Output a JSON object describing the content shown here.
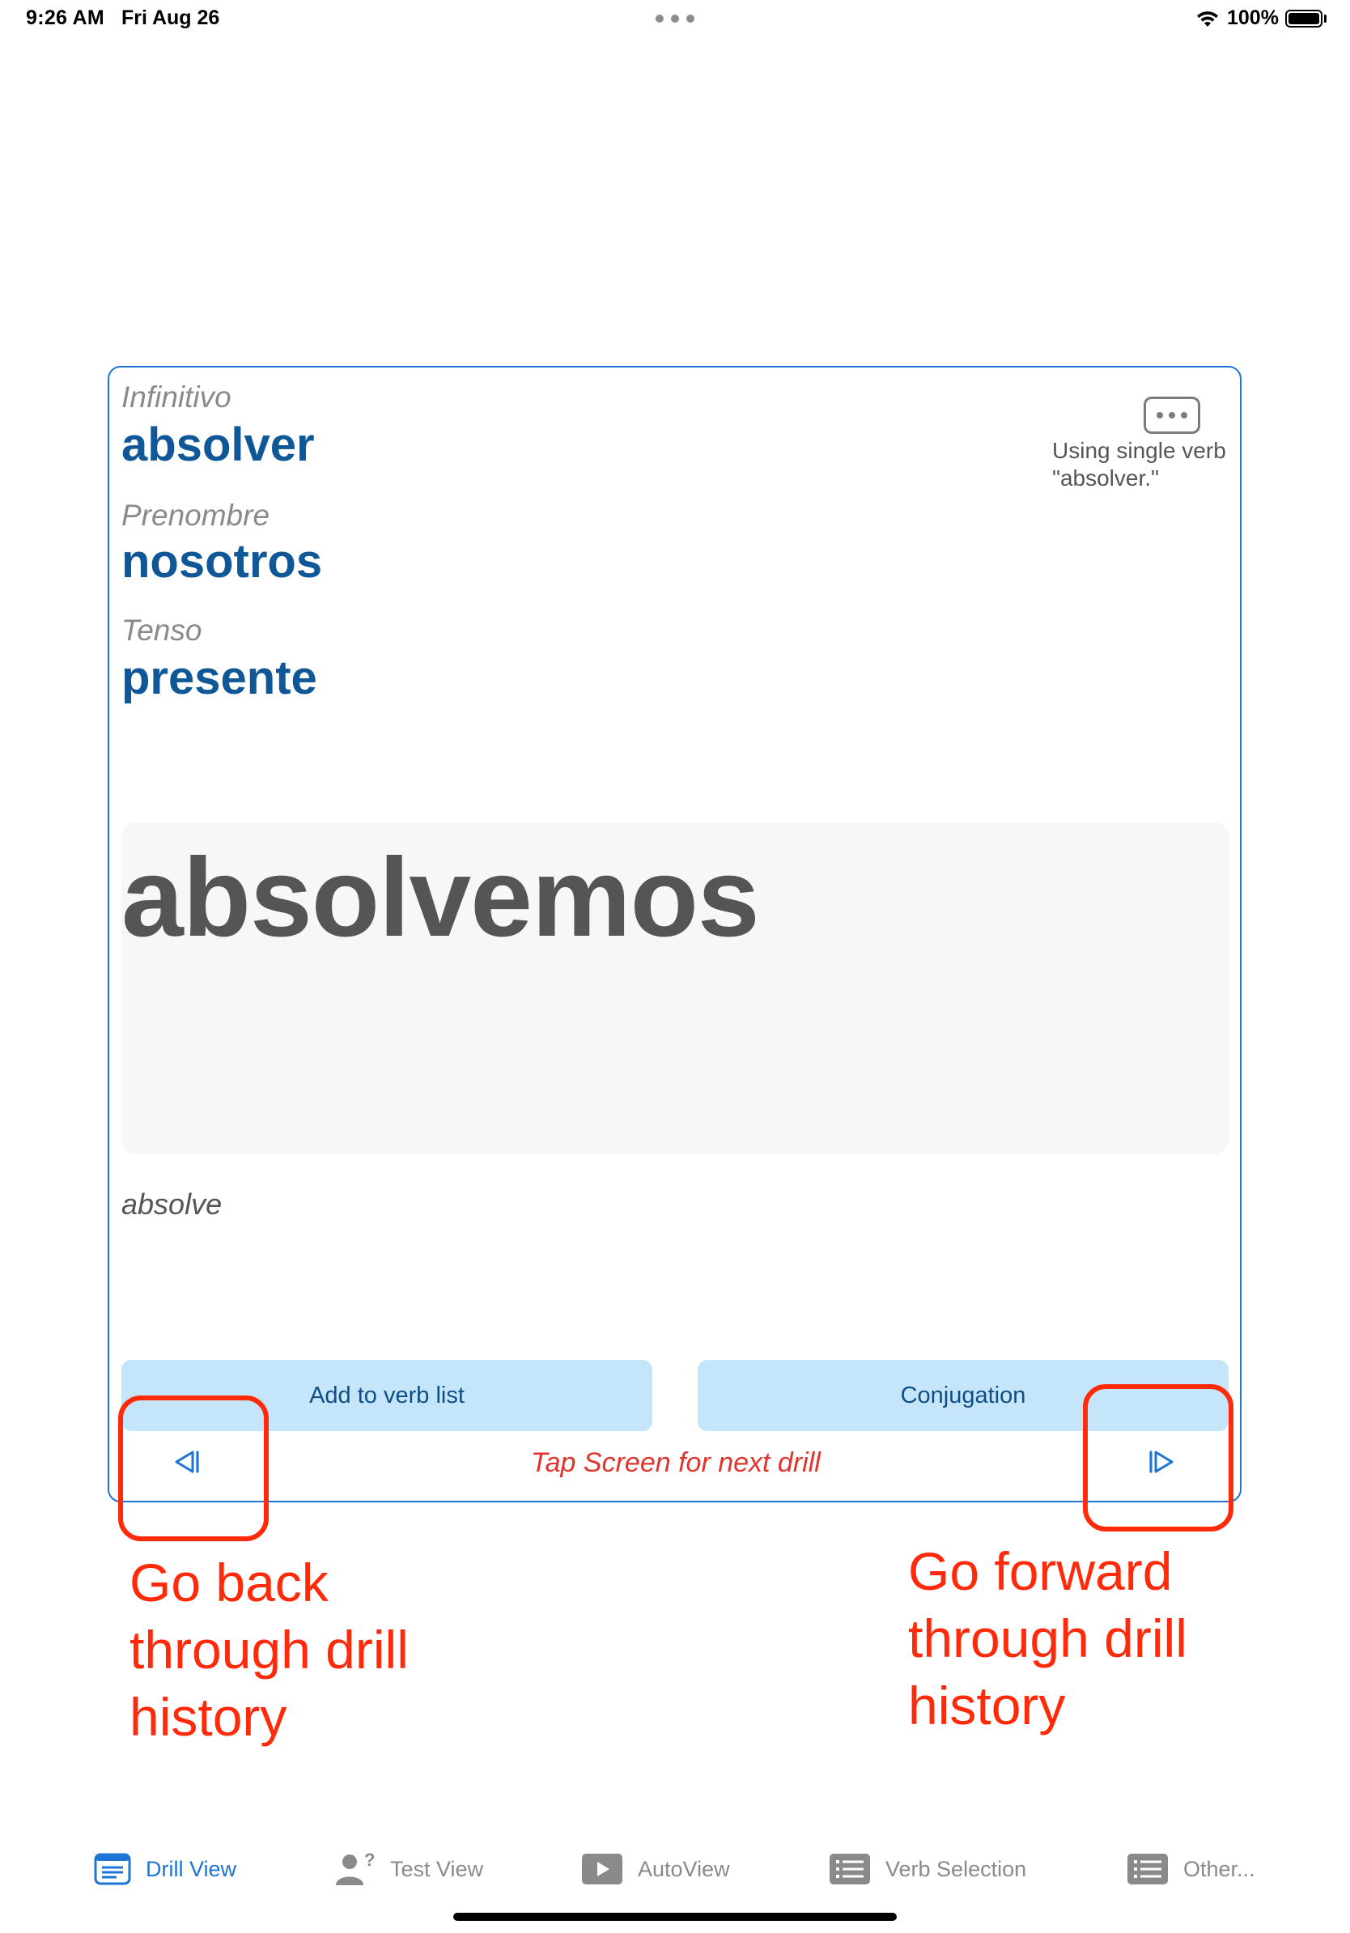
{
  "status_bar": {
    "time": "9:26 AM",
    "date": "Fri Aug 26",
    "battery": "100%"
  },
  "drill": {
    "infinitive_label": "Infinitivo",
    "infinitive_value": "absolver",
    "pronoun_label": "Prenombre",
    "pronoun_value": "nosotros",
    "tense_label": "Tenso",
    "tense_value": "presente",
    "single_verb_note": "Using single verb \"absolver.\"",
    "answer": "absolvemos",
    "hint": "absolve",
    "add_button": "Add to verb list",
    "conjugation_button": "Conjugation",
    "tap_hint": "Tap Screen for next drill"
  },
  "annotations": {
    "back": "Go back through drill history",
    "forward": "Go forward through drill history"
  },
  "tabs": [
    {
      "label": "Drill View",
      "icon": "drill-view-icon",
      "active": true
    },
    {
      "label": "Test View",
      "icon": "test-view-icon",
      "active": false
    },
    {
      "label": "AutoView",
      "icon": "autoview-icon",
      "active": false
    },
    {
      "label": "Verb Selection",
      "icon": "verb-selection-icon",
      "active": false
    },
    {
      "label": "Other...",
      "icon": "other-icon",
      "active": false
    }
  ],
  "colors": {
    "accent": "#1d74d4",
    "value_text": "#0f5797",
    "button_bg": "#c5e5fb",
    "annotation": "#ff2a0a",
    "tap_hint": "#e0342c"
  }
}
